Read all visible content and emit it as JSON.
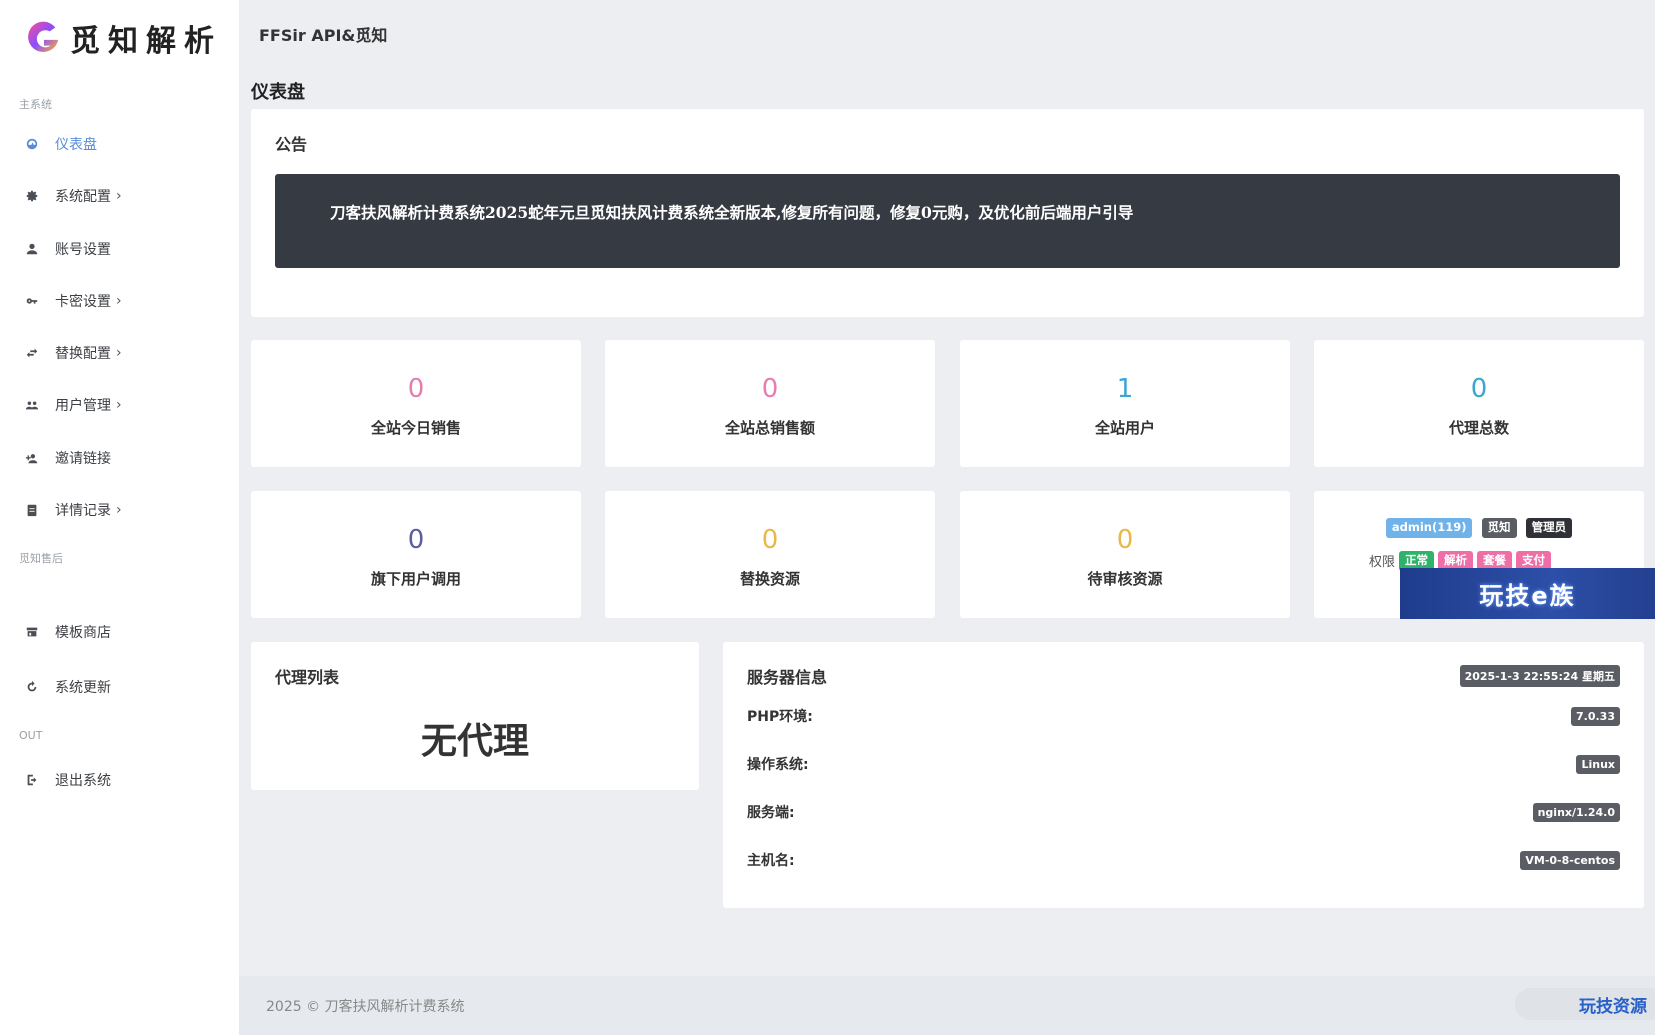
{
  "brand": {
    "name": "觅知解析"
  },
  "topbar": {
    "title": "FFSir API&觅知"
  },
  "sidebar": {
    "section_main": "主系统",
    "section_after": "觅知售后",
    "section_out": "OUT",
    "items": [
      {
        "label": "仪表盘",
        "icon": "dashboard-icon",
        "chevron": ""
      },
      {
        "label": "系统配置",
        "icon": "gear-icon",
        "chevron": "›"
      },
      {
        "label": "账号设置",
        "icon": "user-icon",
        "chevron": ""
      },
      {
        "label": "卡密设置",
        "icon": "key-icon",
        "chevron": "›"
      },
      {
        "label": "替换配置",
        "icon": "swap-icon",
        "chevron": "›"
      },
      {
        "label": "用户管理",
        "icon": "users-icon",
        "chevron": "›"
      },
      {
        "label": "邀请链接",
        "icon": "user-add-icon",
        "chevron": ""
      },
      {
        "label": "详情记录",
        "icon": "clipboard-icon",
        "chevron": "›"
      },
      {
        "label": "模板商店",
        "icon": "store-icon",
        "chevron": ""
      },
      {
        "label": "系统更新",
        "icon": "refresh-icon",
        "chevron": ""
      },
      {
        "label": "退出系统",
        "icon": "logout-icon",
        "chevron": ""
      }
    ]
  },
  "page": {
    "title": "仪表盘"
  },
  "notice": {
    "title": "公告",
    "text": "刀客扶风解析计费系统2025蛇年元旦觅知扶风计费系统全新版本,修复所有问题，修复0元购，及优化前后端用户引导"
  },
  "stats": [
    {
      "value": "0",
      "label": "全站今日销售",
      "color": "#e57fb0"
    },
    {
      "value": "0",
      "label": "全站总销售额",
      "color": "#e57fb0"
    },
    {
      "value": "1",
      "label": "全站用户",
      "color": "#3aa6d1"
    },
    {
      "value": "0",
      "label": "代理总数",
      "color": "#3aa6d1"
    },
    {
      "value": "0",
      "label": "旗下用户调用",
      "color": "#5b5f9e"
    },
    {
      "value": "0",
      "label": "替换资源",
      "color": "#e8b84a"
    },
    {
      "value": "0",
      "label": "待审核资源",
      "color": "#e8b84a"
    }
  ],
  "account": {
    "user_badge": "admin(119)",
    "site_badge": "觅知",
    "role_badge": "管理员",
    "perm_label": "权限",
    "perms": [
      {
        "label": "正常",
        "color": "#2fb36b"
      },
      {
        "label": "解析",
        "color": "#ef6ea8"
      },
      {
        "label": "套餐",
        "color": "#ef6ea8"
      },
      {
        "label": "支付",
        "color": "#ef6ea8"
      }
    ]
  },
  "ad_overlay": {
    "text": "玩技e族"
  },
  "agents": {
    "title": "代理列表",
    "empty": "无代理"
  },
  "server": {
    "title": "服务器信息",
    "datetime": "2025-1-3 22:55:24 星期五",
    "rows": [
      {
        "key": "PHP环境:",
        "value": "7.0.33"
      },
      {
        "key": "操作系统:",
        "value": "Linux"
      },
      {
        "key": "服务端:",
        "value": "nginx/1.24.0"
      },
      {
        "key": "主机名:",
        "value": "VM-0-8-centos"
      }
    ]
  },
  "footer": {
    "text": "2025 © 刀客扶风解析计费系统",
    "brand": "玩技资源"
  }
}
